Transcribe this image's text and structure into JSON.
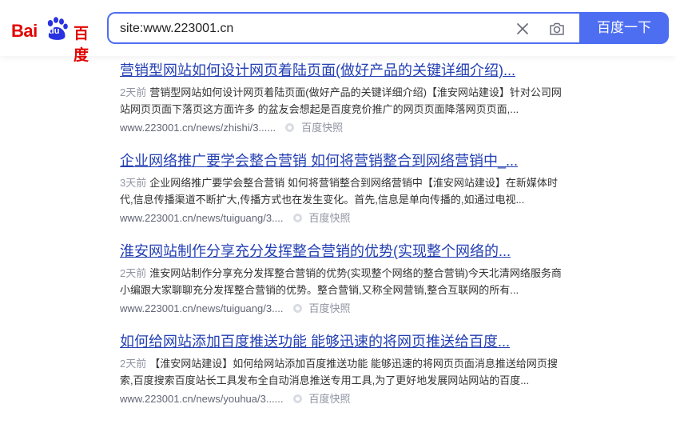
{
  "logo": {
    "bai": "Bai",
    "du": "du",
    "cn": "百度"
  },
  "search": {
    "query": "site:www.223001.cn",
    "button_label": "百度一下"
  },
  "results": [
    {
      "title": "营销型网站如何设计网页着陆页面(做好产品的关键详细介绍)...",
      "date": "2天前",
      "abstract": "营销型网站如何设计网页着陆页面(做好产品的关键详细介绍)【淮安网站建设】针对公司网站网页页面下落页这方面许多 的盆友会想起是百度竞价推广的网页页面降落网页页面,...",
      "url": "www.223001.cn/news/zhishi/3......",
      "snapshot": "百度快照"
    },
    {
      "title": "企业网络推广要学会整合营销 如何将营销整合到网络营销中_...",
      "date": "3天前",
      "abstract": "企业网络推广要学会整合营销 如何将营销整合到网络营销中【淮安网站建设】在新媒体时代,信息传播渠道不断扩大,传播方式也在发生变化。首先,信息是单向传播的,如通过电视...",
      "url": "www.223001.cn/news/tuiguang/3....",
      "snapshot": "百度快照"
    },
    {
      "title": "淮安网站制作分享充分发挥整合营销的优势(实现整个网络的...",
      "date": "2天前",
      "abstract": "淮安网站制作分享充分发挥整合营销的优势(实现整个网络的整合营销)今天北清网络服务商小编跟大家聊聊充分发挥整合营销的优势。整合营销,又称全网营销,整合互联网的所有...",
      "url": "www.223001.cn/news/tuiguang/3....",
      "snapshot": "百度快照"
    },
    {
      "title": "如何给网站添加百度推送功能 能够迅速的将网页推送给百度...",
      "date": "2天前",
      "abstract": "【淮安网站建设】如何给网站添加百度推送功能 能够迅速的将网页页面消息推送给网页搜索,百度搜索百度站长工具发布全自动消息推送专用工具,为了更好地发展网站网站的百度...",
      "url": "www.223001.cn/news/youhua/3......",
      "snapshot": "百度快照"
    }
  ]
}
